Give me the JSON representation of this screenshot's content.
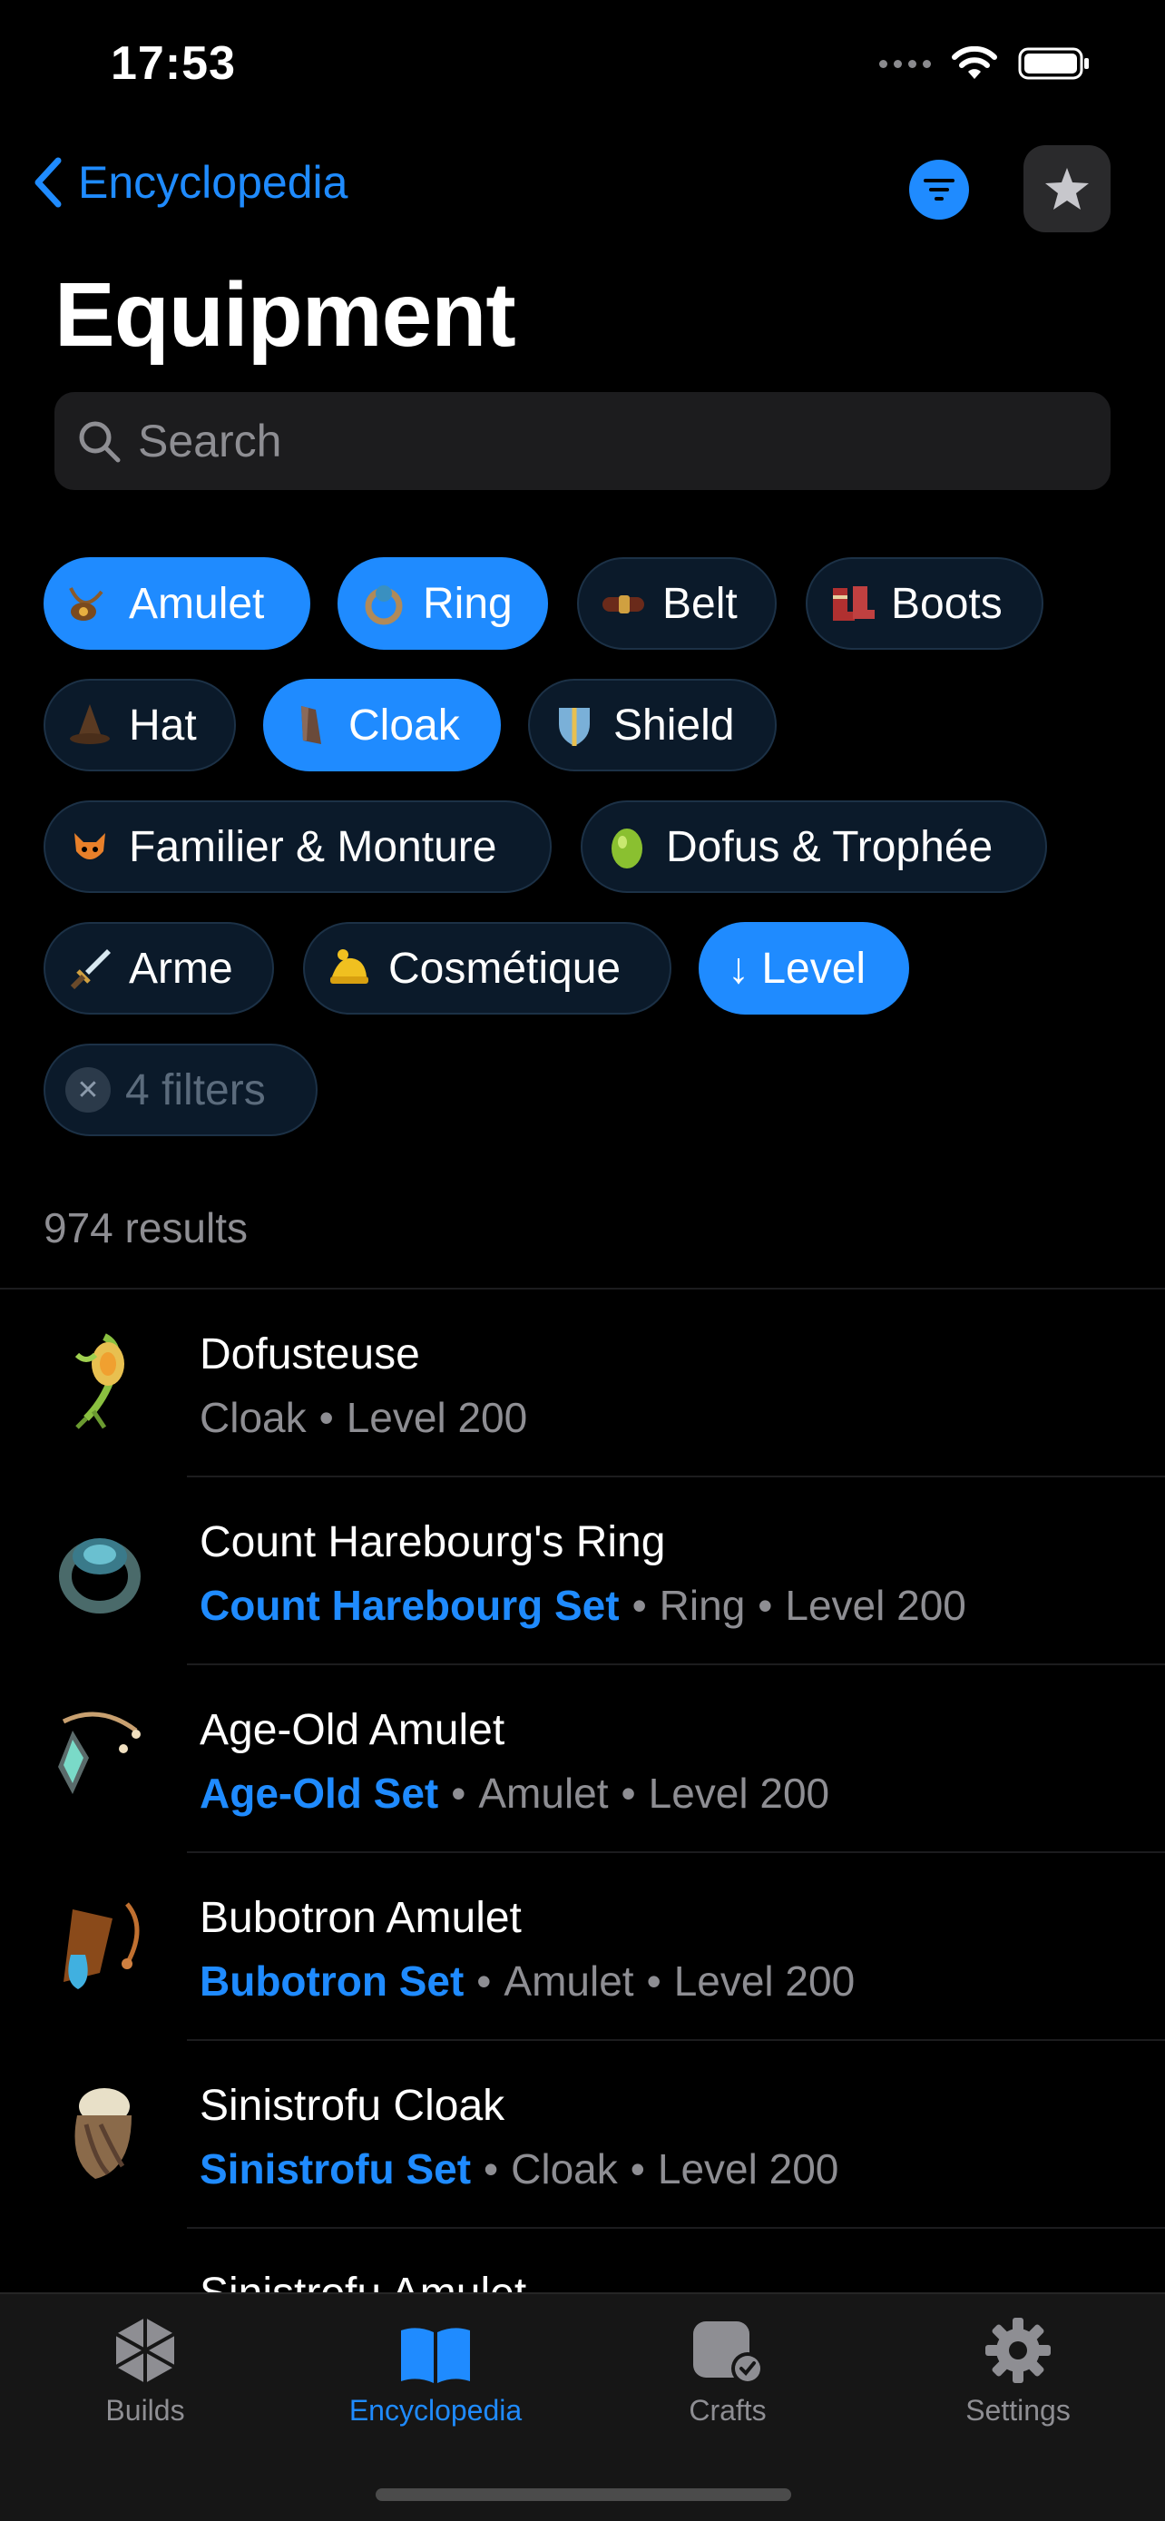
{
  "status": {
    "time": "17:53"
  },
  "nav": {
    "back_label": "Encyclopedia"
  },
  "page": {
    "title": "Equipment"
  },
  "search": {
    "placeholder": "Search"
  },
  "chips": [
    {
      "label": "Amulet",
      "active": true,
      "icon": "amulet-icon"
    },
    {
      "label": "Ring",
      "active": true,
      "icon": "ring-icon"
    },
    {
      "label": "Belt",
      "active": false,
      "icon": "belt-icon"
    },
    {
      "label": "Boots",
      "active": false,
      "icon": "boots-icon"
    },
    {
      "label": "Hat",
      "active": false,
      "icon": "hat-icon"
    },
    {
      "label": "Cloak",
      "active": true,
      "icon": "cloak-icon"
    },
    {
      "label": "Shield",
      "active": false,
      "icon": "shield-icon"
    },
    {
      "label": "Familier & Monture",
      "active": false,
      "icon": "pet-icon"
    },
    {
      "label": "Dofus & Trophée",
      "active": false,
      "icon": "dofus-egg-icon"
    },
    {
      "label": "Arme",
      "active": false,
      "icon": "sword-icon"
    },
    {
      "label": "Cosmétique",
      "active": false,
      "icon": "cosmetic-icon"
    },
    {
      "label": "↓ Level",
      "active": true,
      "icon": ""
    }
  ],
  "clear_filters": {
    "label": "4 filters"
  },
  "results": {
    "count_label": "974 results"
  },
  "items": [
    {
      "name": "Dofusteuse",
      "set": "",
      "type": "Cloak",
      "level": "Level 200"
    },
    {
      "name": "Count Harebourg's Ring",
      "set": "Count Harebourg Set",
      "type": "Ring",
      "level": "Level 200"
    },
    {
      "name": "Age-Old Amulet",
      "set": "Age-Old Set",
      "type": "Amulet",
      "level": "Level 200"
    },
    {
      "name": "Bubotron Amulet",
      "set": "Bubotron Set",
      "type": "Amulet",
      "level": "Level 200"
    },
    {
      "name": "Sinistrofu Cloak",
      "set": "Sinistrofu Set",
      "type": "Cloak",
      "level": "Level 200"
    },
    {
      "name": "Sinistrofu Amulet",
      "set": "",
      "type": "",
      "level": ""
    }
  ],
  "tabs": [
    {
      "label": "Builds",
      "icon": "builds-cube-icon",
      "active": false
    },
    {
      "label": "Encyclopedia",
      "icon": "book-icon",
      "active": true
    },
    {
      "label": "Crafts",
      "icon": "crafts-icon",
      "active": false
    },
    {
      "label": "Settings",
      "icon": "gear-icon",
      "active": false
    }
  ],
  "colors": {
    "accent": "#1f8bff",
    "background": "#000000",
    "chip_bg": "#0b1a2a",
    "secondary_text": "#8e8e93"
  }
}
